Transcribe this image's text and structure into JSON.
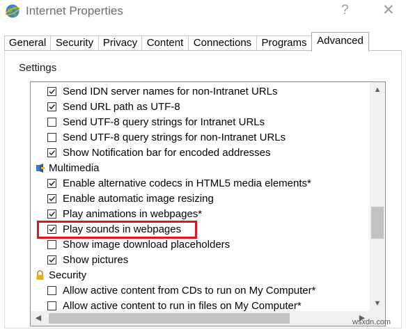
{
  "window": {
    "title": "Internet Properties",
    "help_symbol": "?",
    "close_symbol": "✕"
  },
  "tabs": [
    {
      "label": "General"
    },
    {
      "label": "Security"
    },
    {
      "label": "Privacy"
    },
    {
      "label": "Content"
    },
    {
      "label": "Connections"
    },
    {
      "label": "Programs"
    },
    {
      "label": "Advanced",
      "active": true
    }
  ],
  "settings_label": "Settings",
  "settings_list": [
    {
      "type": "checkbox",
      "checked": true,
      "label": "Send IDN server names for non-Intranet URLs"
    },
    {
      "type": "checkbox",
      "checked": true,
      "label": "Send URL path as UTF-8"
    },
    {
      "type": "checkbox",
      "checked": false,
      "label": "Send UTF-8 query strings for Intranet URLs"
    },
    {
      "type": "checkbox",
      "checked": false,
      "label": "Send UTF-8 query strings for non-Intranet URLs"
    },
    {
      "type": "checkbox",
      "checked": true,
      "label": "Show Notification bar for encoded addresses"
    },
    {
      "type": "category",
      "icon": "multimedia-icon",
      "label": "Multimedia"
    },
    {
      "type": "checkbox",
      "checked": true,
      "label": "Enable alternative codecs in HTML5 media elements*"
    },
    {
      "type": "checkbox",
      "checked": true,
      "label": "Enable automatic image resizing"
    },
    {
      "type": "checkbox",
      "checked": true,
      "label": "Play animations in webpages*"
    },
    {
      "type": "checkbox",
      "checked": true,
      "label": "Play sounds in webpages",
      "highlighted": true
    },
    {
      "type": "checkbox",
      "checked": false,
      "label": "Show image download placeholders"
    },
    {
      "type": "checkbox",
      "checked": true,
      "label": "Show pictures"
    },
    {
      "type": "category",
      "icon": "lock-icon",
      "label": "Security"
    },
    {
      "type": "checkbox",
      "checked": false,
      "label": "Allow active content from CDs to run on My Computer*"
    },
    {
      "type": "checkbox",
      "checked": false,
      "label": "Allow active content to run in files on My Computer*"
    }
  ],
  "colors": {
    "highlight": "#e3131b",
    "scroll_thumb": "#c2c2c2"
  },
  "watermark": "wsxdn.com"
}
